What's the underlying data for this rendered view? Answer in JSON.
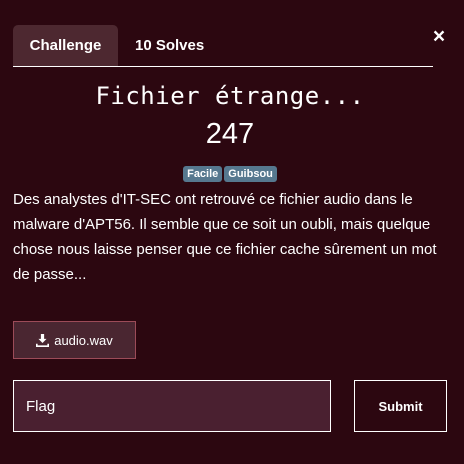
{
  "header": {
    "close_label": "×"
  },
  "tabs": [
    {
      "label": "Challenge",
      "active": true
    },
    {
      "label": "10 Solves",
      "active": false
    }
  ],
  "challenge": {
    "title": "Fichier étrange...",
    "value": "247",
    "tags": [
      "Facile",
      "Guibsou"
    ],
    "description": "Des analystes d'IT-SEC ont retrouvé ce fichier audio dans le malware d'APT56. Il semble que ce soit un oubli, mais quelque chose nous laisse penser que ce fichier cache sûrement un mot de passe...",
    "file": {
      "label": "audio.wav",
      "icon": "download-icon"
    }
  },
  "form": {
    "flag_placeholder": "Flag",
    "submit_label": "Submit"
  },
  "colors": {
    "background": "#2c0710",
    "active_tab": "#4d2830",
    "tag": "#56788f",
    "input_bg": "#4a2030",
    "file_border": "#9c4b58"
  }
}
